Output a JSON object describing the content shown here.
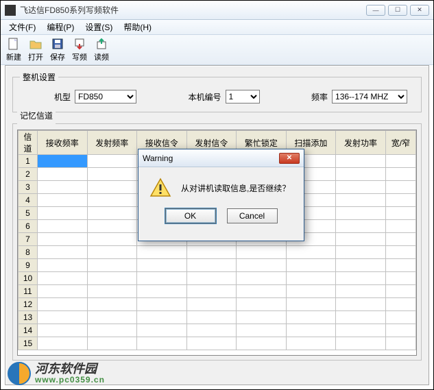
{
  "window": {
    "title": "飞达信FD850系列写频软件"
  },
  "menu": {
    "file": "文件(F)",
    "program": "编程(P)",
    "settings": "设置(S)",
    "help": "帮助(H)"
  },
  "toolbar": {
    "new": "新建",
    "open": "打开",
    "save": "保存",
    "write": "写频",
    "read": "读频"
  },
  "settings_panel": {
    "legend": "整机设置",
    "model_label": "机型",
    "model_value": "FD850",
    "num_label": "本机编号",
    "num_value": "1",
    "freq_label": "频率",
    "freq_value": "136--174 MHZ"
  },
  "channels_panel": {
    "legend": "记忆信道",
    "headers": [
      "信道",
      "接收频率",
      "发射频率",
      "接收信令",
      "发射信令",
      "繁忙锁定",
      "扫描添加",
      "发射功率",
      "宽/窄"
    ],
    "rows": [
      "1",
      "2",
      "3",
      "4",
      "5",
      "6",
      "7",
      "8",
      "9",
      "10",
      "11",
      "12",
      "13",
      "14",
      "15"
    ]
  },
  "dialog": {
    "title": "Warning",
    "message": "从对讲机读取信息,是否继续？",
    "ok": "OK",
    "cancel": "Cancel"
  },
  "watermark": {
    "name": "河东软件园",
    "url": "www.pc0359.cn"
  }
}
